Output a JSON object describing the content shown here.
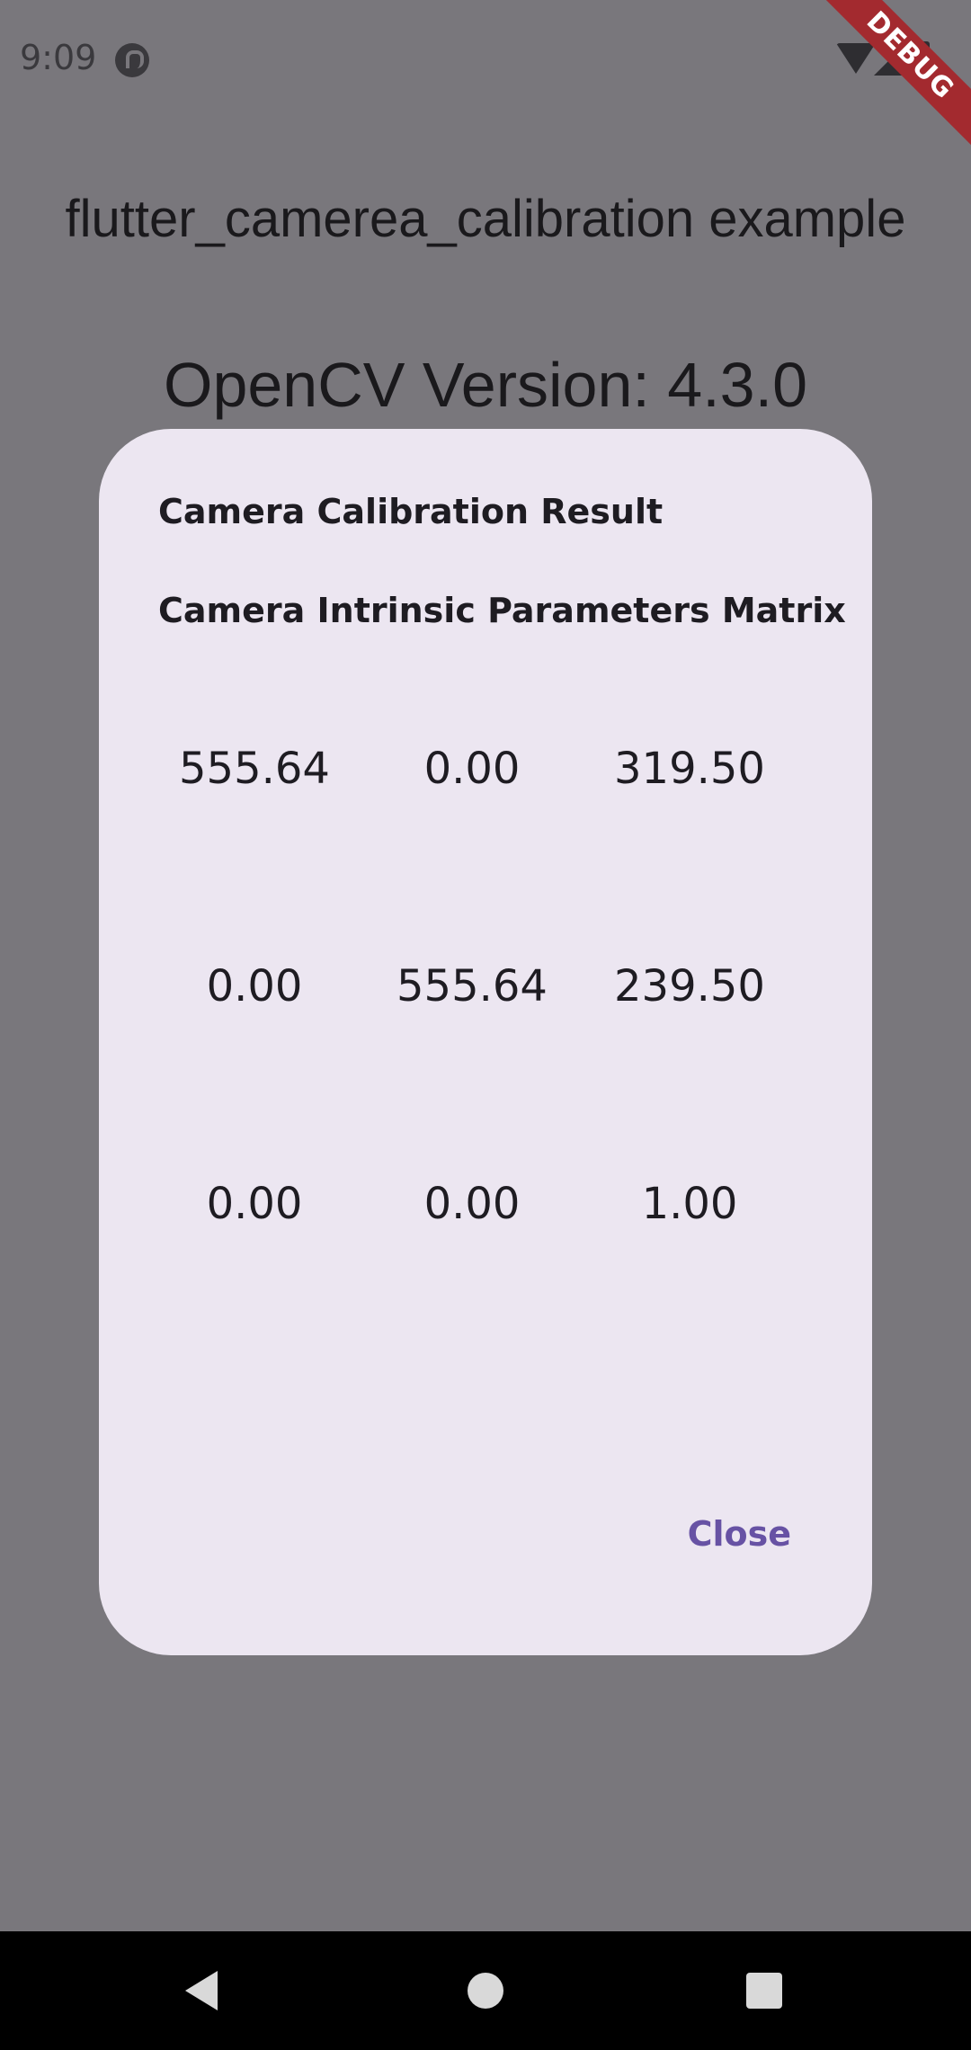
{
  "status_bar": {
    "time": "9:09",
    "icons": [
      "app-notification-icon",
      "wifi-icon",
      "cell-signal-icon",
      "battery-icon"
    ]
  },
  "debug_banner": "DEBUG",
  "app": {
    "title": "flutter_camerea_calibration example",
    "opencv_version": "OpenCV Version: 4.3.0"
  },
  "dialog": {
    "title": "Camera Calibration Result",
    "subtitle": "Camera Intrinsic Parameters Matrix",
    "matrix": [
      [
        "555.64",
        "0.00",
        "319.50"
      ],
      [
        "0.00",
        "555.64",
        "239.50"
      ],
      [
        "0.00",
        "0.00",
        "1.00"
      ]
    ],
    "close_label": "Close",
    "background_color": "#ece6f1",
    "accent_color": "#6752a4"
  },
  "nav_bar": {
    "icons": [
      "back-icon",
      "home-icon",
      "recents-icon"
    ]
  }
}
